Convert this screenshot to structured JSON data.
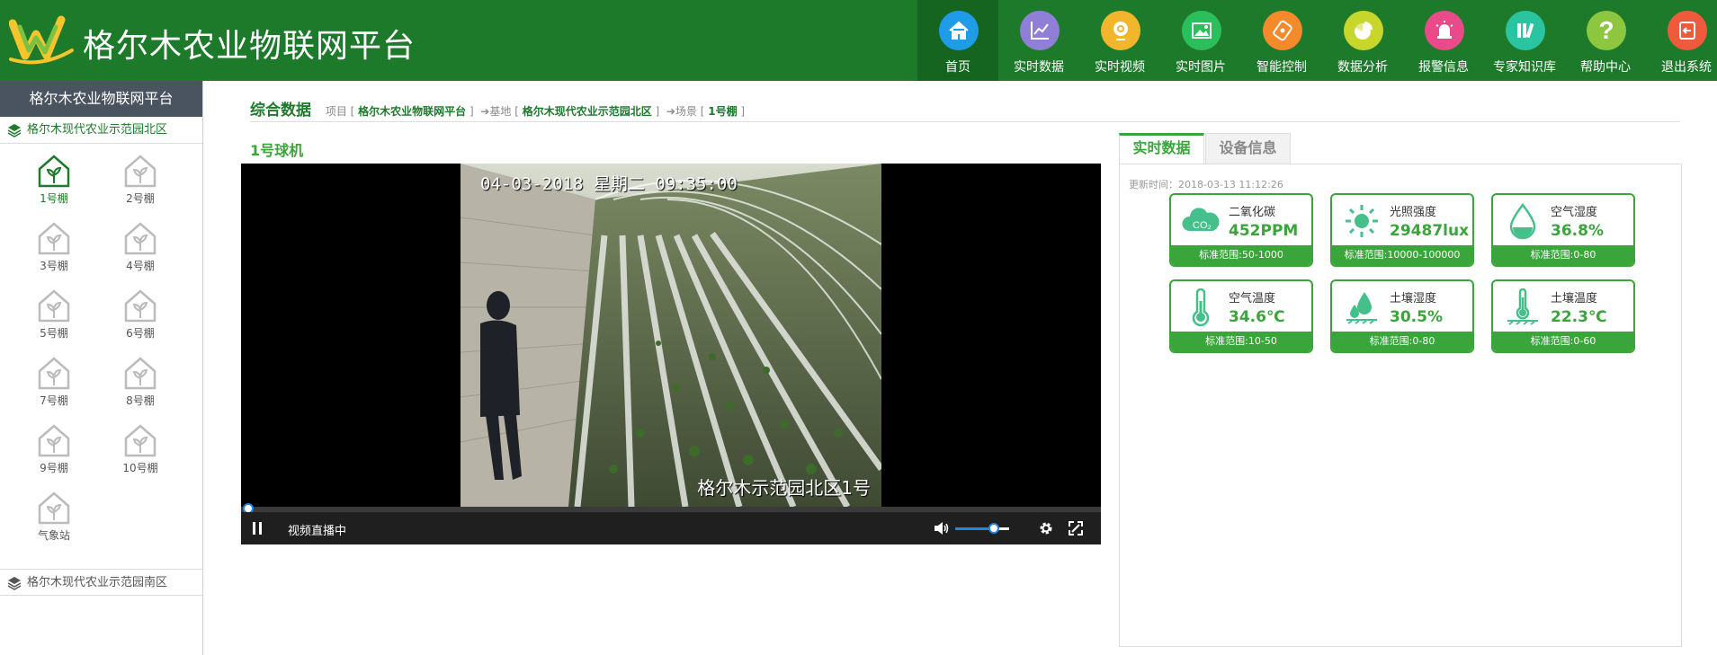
{
  "header": {
    "title": "格尔木农业物联网平台",
    "nav": [
      {
        "label": "首页",
        "icon": "home-icon",
        "color": "#1e9ce8",
        "active": true
      },
      {
        "label": "实时数据",
        "icon": "line-chart-icon",
        "color": "#8f7fd6",
        "active": false
      },
      {
        "label": "实时视频",
        "icon": "webcam-icon",
        "color": "#f2b62c",
        "active": false
      },
      {
        "label": "实时图片",
        "icon": "picture-icon",
        "color": "#2bbf5b",
        "active": false
      },
      {
        "label": "智能控制",
        "icon": "control-icon",
        "color": "#f58a2a",
        "active": false
      },
      {
        "label": "数据分析",
        "icon": "pie-chart-icon",
        "color": "#c7d62b",
        "active": false
      },
      {
        "label": "报警信息",
        "icon": "alarm-icon",
        "color": "#e94b8a",
        "active": false
      },
      {
        "label": "专家知识库",
        "icon": "books-icon",
        "color": "#2bc4a0",
        "active": false
      },
      {
        "label": "帮助中心",
        "icon": "help-icon",
        "color": "#8dc63f",
        "active": false
      },
      {
        "label": "退出系统",
        "icon": "exit-icon",
        "color": "#ef5a3c",
        "active": false
      }
    ]
  },
  "sidebar": {
    "title": "格尔木农业物联网平台",
    "group_north": "格尔木现代农业示范园北区",
    "group_south": "格尔木现代农业示范园南区",
    "houses": [
      "1号棚",
      "2号棚",
      "3号棚",
      "4号棚",
      "5号棚",
      "6号棚",
      "7号棚",
      "8号棚",
      "9号棚",
      "10号棚",
      "气象站"
    ]
  },
  "breadcrumb": {
    "title": "综合数据",
    "project_label": "项目",
    "project": "格尔木农业物联网平台",
    "base_label": "基地",
    "base": "格尔木现代农业示范园北区",
    "scene_label": "场景",
    "scene": "1号棚"
  },
  "camera": {
    "title": "1号球机",
    "osd_time": "04-03-2018  星期二  09:35:00",
    "osd_label": "格尔木示范园北区1号",
    "status": "视频直播中",
    "volume": 0.72
  },
  "realtime": {
    "tab_data": "实时数据",
    "tab_device": "设备信息",
    "update_time": "更新时间：2018-03-13 11:12:26",
    "cards": [
      {
        "name": "二氧化碳",
        "value": "452PPM",
        "range": "标准范围:50-1000",
        "icon": "co2-cloud-icon"
      },
      {
        "name": "光照强度",
        "value": "29487lux",
        "range": "标准范围:10000-100000",
        "icon": "sun-icon"
      },
      {
        "name": "空气湿度",
        "value": "36.8%",
        "range": "标准范围:0-80",
        "icon": "water-drop-icon"
      },
      {
        "name": "空气温度",
        "value": "34.6℃",
        "range": "标准范围:10-50",
        "icon": "thermometer-icon"
      },
      {
        "name": "土壤湿度",
        "value": "30.5%",
        "range": "标准范围:0-80",
        "icon": "soil-drop-icon"
      },
      {
        "name": "土壤温度",
        "value": "22.3℃",
        "range": "标准范围:0-60",
        "icon": "soil-thermometer-icon"
      }
    ]
  }
}
